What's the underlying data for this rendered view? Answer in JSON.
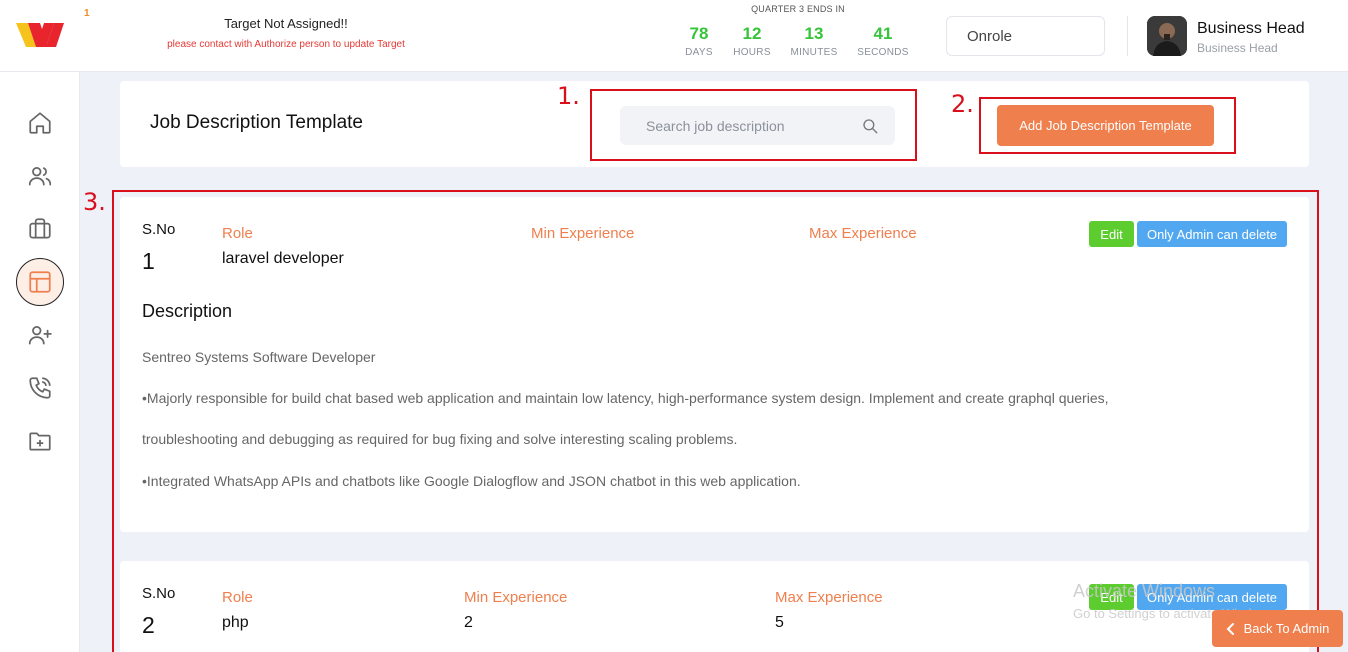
{
  "header": {
    "logo_badge": "1",
    "target_title": "Target Not Assigned!!",
    "target_subtitle": "please contact with Authorize person to update Target",
    "quarter_label": "QUARTER 3 ENDS IN",
    "countdown": [
      {
        "value": "78",
        "label": "DAYS"
      },
      {
        "value": "12",
        "label": "HOURS"
      },
      {
        "value": "13",
        "label": "MINUTES"
      },
      {
        "value": "41",
        "label": "SECONDS"
      }
    ],
    "role_select": "Onrole",
    "user_name": "Business Head",
    "user_role": "Business Head"
  },
  "sidebar": {
    "items": [
      {
        "icon": "home-icon",
        "active": false
      },
      {
        "icon": "users-icon",
        "active": false
      },
      {
        "icon": "briefcase-icon",
        "active": false
      },
      {
        "icon": "template-icon",
        "active": true
      },
      {
        "icon": "user-plus-icon",
        "active": false
      },
      {
        "icon": "phone-icon",
        "active": false
      },
      {
        "icon": "folder-plus-icon",
        "active": false
      }
    ]
  },
  "page": {
    "title": "Job Description Template",
    "search_placeholder": "Search job description",
    "add_button": "Add Job Description Template"
  },
  "annotations": {
    "one": "1.",
    "two": "2.",
    "three": "3."
  },
  "labels": {
    "sno": "S.No",
    "role": "Role",
    "min_exp": "Min Experience",
    "max_exp": "Max Experience",
    "edit": "Edit",
    "delete": "Only Admin can delete",
    "description": "Description"
  },
  "records": [
    {
      "sno": "1",
      "role": "laravel developer",
      "min_experience": "",
      "max_experience": "",
      "description": [
        "Sentreo Systems Software Developer",
        "•Majorly responsible for build chat based web application and maintain low latency, high-performance system design. Implement and create graphql queries,",
        "troubleshooting and debugging as required for bug fixing and solve interesting scaling problems.",
        "•Integrated WhatsApp APIs and chatbots like Google Dialogflow and JSON chatbot in this web application."
      ]
    },
    {
      "sno": "2",
      "role": "php",
      "min_experience": "2",
      "max_experience": "5"
    }
  ],
  "watermark": {
    "line1": "Activate Windows",
    "line2": "Go to Settings to activate Windows."
  },
  "back_button": "Back To Admin",
  "colors": {
    "accent": "#ef7f4d",
    "green": "#5ccc2f",
    "blue": "#52a8f0",
    "countdown": "#35c43a",
    "annotation": "#d9101c"
  }
}
